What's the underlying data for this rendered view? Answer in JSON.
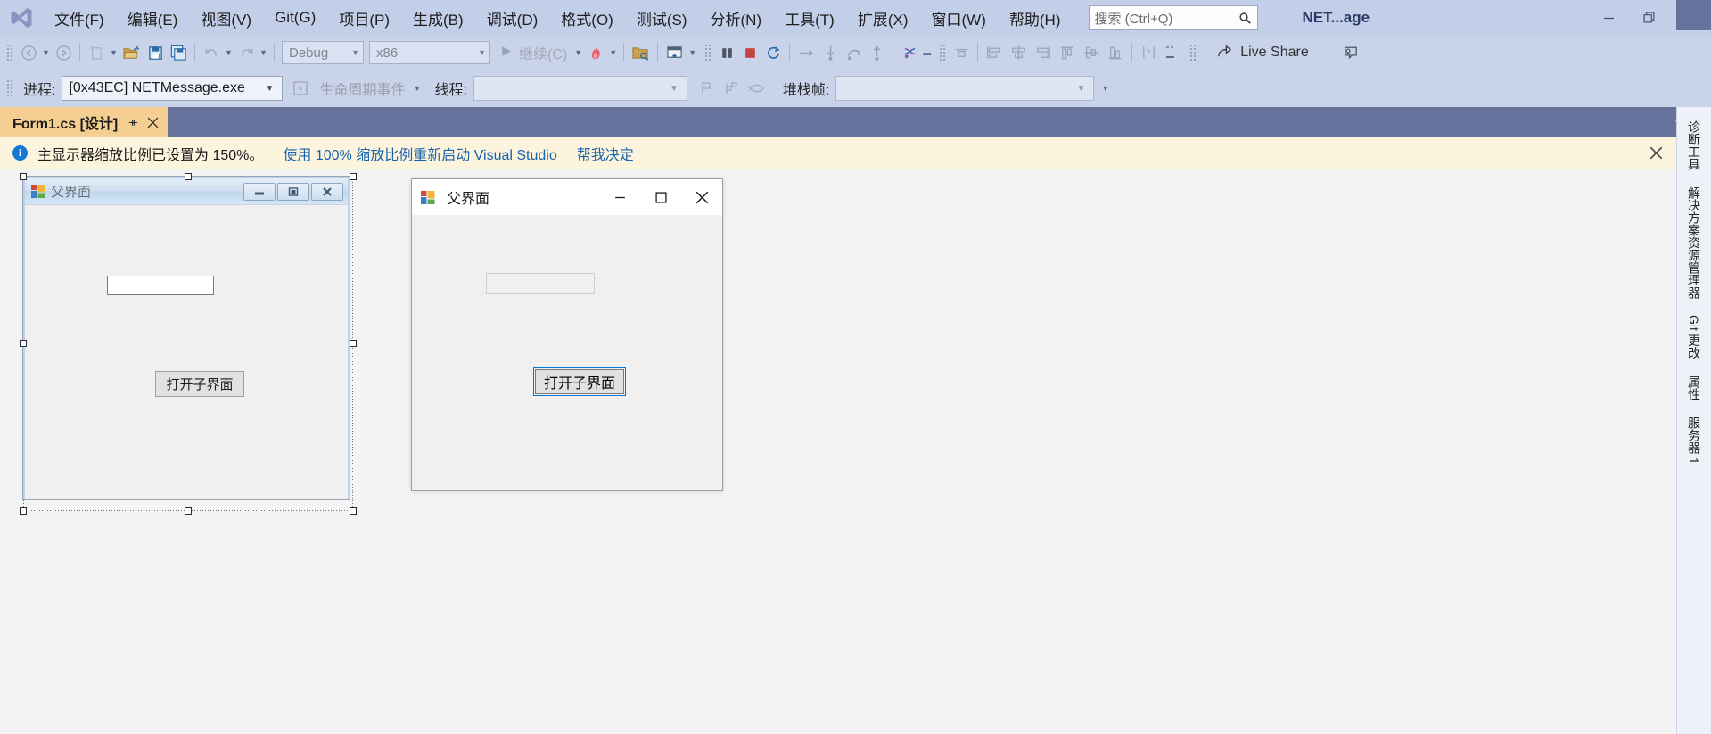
{
  "window": {
    "app_title": "NET...age",
    "logo_icon": "visual-studio-logo",
    "controls": {
      "minimize": "—",
      "restore": "❐",
      "close": "✕"
    }
  },
  "menu": {
    "items": [
      {
        "label": "文件(F)",
        "name": "file"
      },
      {
        "label": "编辑(E)",
        "name": "edit"
      },
      {
        "label": "视图(V)",
        "name": "view"
      },
      {
        "label": "Git(G)",
        "name": "git"
      },
      {
        "label": "项目(P)",
        "name": "project"
      },
      {
        "label": "生成(B)",
        "name": "build"
      },
      {
        "label": "调试(D)",
        "name": "debug"
      },
      {
        "label": "格式(O)",
        "name": "format"
      },
      {
        "label": "测试(S)",
        "name": "test"
      },
      {
        "label": "分析(N)",
        "name": "analyze"
      },
      {
        "label": "工具(T)",
        "name": "tools"
      },
      {
        "label": "扩展(X)",
        "name": "extensions"
      },
      {
        "label": "窗口(W)",
        "name": "window"
      },
      {
        "label": "帮助(H)",
        "name": "help"
      }
    ]
  },
  "search": {
    "placeholder": "搜索 (Ctrl+Q)",
    "value": "",
    "icon": "search-icon"
  },
  "toolbar": {
    "nav_back_icon": "arrow-back-circle-icon",
    "nav_forward_icon": "arrow-forward-circle-icon",
    "new_item_icon": "new-item-icon",
    "open_file_icon": "open-folder-icon",
    "save_icon": "save-icon",
    "save_all_icon": "save-all-icon",
    "undo_icon": "undo-icon",
    "redo_icon": "redo-icon",
    "configuration": "Debug",
    "platform": "x86",
    "startup_project": "",
    "continue_label": "继续(C)",
    "continue_icon": "play-icon",
    "hot_reload_icon": "hot-reload-flame-icon",
    "attach_icon": "attach-to-process-icon",
    "window_layout_icon": "window-layout-icon",
    "break_all_icon": "pause-icon",
    "stop_icon": "stop-icon",
    "restart_icon": "restart-icon",
    "step_over_icon": "step-over-icon",
    "step_into_icon": "step-into-icon",
    "step_out_arc_icon": "step-out-arc-icon",
    "step_out_icon": "step-out-icon",
    "thread_icon": "threads-icon",
    "stack_icon": "stack-icon",
    "align_left_icon": "align-left-icon",
    "align_center_icon": "align-center-icon",
    "align_right_icon": "align-right-icon",
    "align_top_icon": "align-top-icon",
    "align_middle_icon": "align-middle-icon",
    "align_bottom_icon": "align-bottom-icon",
    "format_icon": "format-icon",
    "live_share_label": "Live Share",
    "live_share_icon": "live-share-icon",
    "feedback_icon": "feedback-person-icon"
  },
  "debug_toolbar": {
    "process_label": "进程:",
    "process_value": "[0x43EC] NETMessage.exe",
    "lifecycle_label": "生命周期事件",
    "lifecycle_icon": "lifecycle-events-icon",
    "thread_label": "线程:",
    "thread_value": "",
    "flag_icon": "flag-icon",
    "flag_group_icon": "flag-group-icon",
    "fish_icon": "fish-icon",
    "stack_frame_label": "堆栈帧:",
    "stack_frame_value": ""
  },
  "tabs": {
    "active": {
      "label": "Form1.cs [设计]",
      "pin_icon": "pin-icon",
      "close_icon": "close-icon"
    },
    "right_icons": [
      "chevron-down-icon",
      "gear-icon"
    ]
  },
  "notification": {
    "icon": "info-icon",
    "message": "主显示器缩放比例已设置为 150%。",
    "links": [
      "使用 100% 缩放比例重新启动 Visual Studio",
      "帮我决定"
    ],
    "close_icon": "close-icon"
  },
  "designer": {
    "design_form": {
      "title": "父界面",
      "icon": "winforms-icon",
      "minimize": "—",
      "maximize": "❐",
      "close": "✕",
      "textbox_value": "",
      "button_label": "打开子界面"
    },
    "runtime_form": {
      "title": "父界面",
      "icon": "winforms-icon",
      "minimize": "—",
      "maximize": "❐",
      "close": "✕",
      "textbox_value": "",
      "button_label": "打开子界面"
    }
  },
  "right_rail": {
    "items": [
      "诊断工具",
      "解决方案资源管理器",
      "Git 更改",
      "属性",
      "服务器 1"
    ]
  },
  "colors": {
    "titlebar": "#c3cee8",
    "toolbar": "#c9d3ea",
    "tabstrip": "#65729c",
    "active_tab": "#f5cf91",
    "notification_bg": "#fdf4dd",
    "link": "#1763ad",
    "designer_bg": "#f4f4f4",
    "accent_blue": "#0078d7"
  }
}
